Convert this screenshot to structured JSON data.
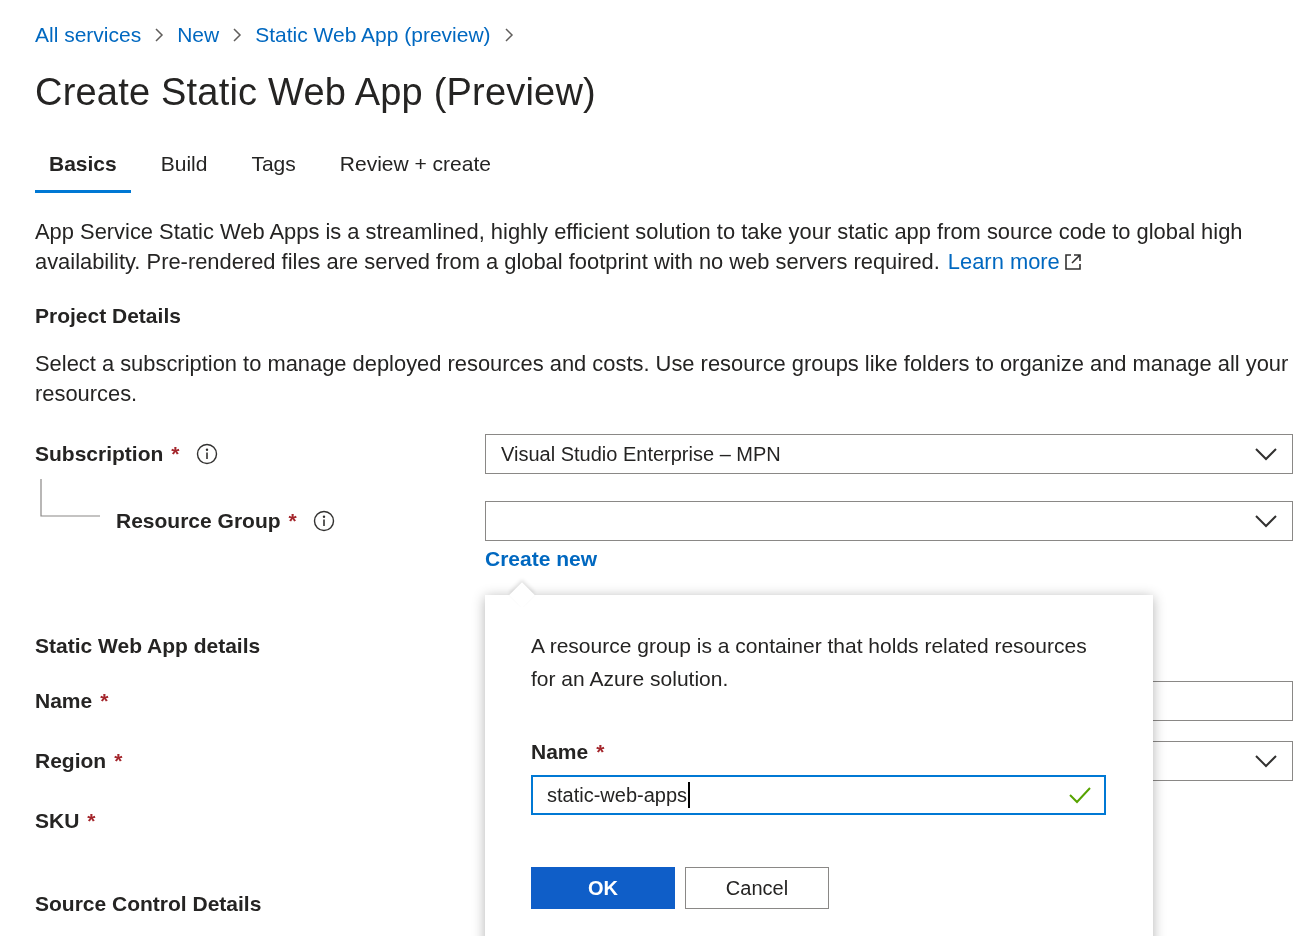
{
  "breadcrumb": [
    {
      "label": "All services"
    },
    {
      "label": "New"
    },
    {
      "label": "Static Web App (preview)"
    }
  ],
  "title": "Create Static Web App (Preview)",
  "tabs": [
    {
      "label": "Basics",
      "selected": true
    },
    {
      "label": "Build",
      "selected": false
    },
    {
      "label": "Tags",
      "selected": false
    },
    {
      "label": "Review + create",
      "selected": false
    }
  ],
  "description": {
    "text": "App Service Static Web Apps is a streamlined, highly efficient solution to take your static app from source code to global high availability. Pre-rendered files are served from a global footprint with no web servers required.",
    "link": "Learn more"
  },
  "sections": [
    {
      "heading": "Project Details",
      "text": "Select a subscription to manage deployed resources and costs. Use resource groups like folders to organize and manage all your resources.",
      "fields": [
        {
          "label": "Subscription",
          "required_mark": "*",
          "info": true,
          "kind": "dropdown",
          "value": "Visual Studio Enterprise – MPN",
          "children": [
            {
              "label": "Resource Group",
              "required_mark": "*",
              "info": true,
              "kind": "dropdown",
              "link": "Create new"
            }
          ]
        }
      ]
    },
    {
      "heading": "Static Web App details",
      "fields": [
        {
          "label": "Name",
          "required_mark": "*",
          "kind": "text"
        },
        {
          "label": "Region",
          "required_mark": "*",
          "kind": "dropdown"
        },
        {
          "label": "SKU",
          "required_mark": "*",
          "kind": "none"
        }
      ]
    },
    {
      "heading": "Source Control Details"
    }
  ],
  "popup": {
    "text": "A resource group is a container that holds related resources for an Azure solution.",
    "field": {
      "label": "Name",
      "required_mark": "*",
      "value": "static-web-apps",
      "valid": true
    },
    "buttons": [
      {
        "label": "OK",
        "kind": "primary"
      },
      {
        "label": "Cancel",
        "kind": "secondary"
      }
    ]
  }
}
